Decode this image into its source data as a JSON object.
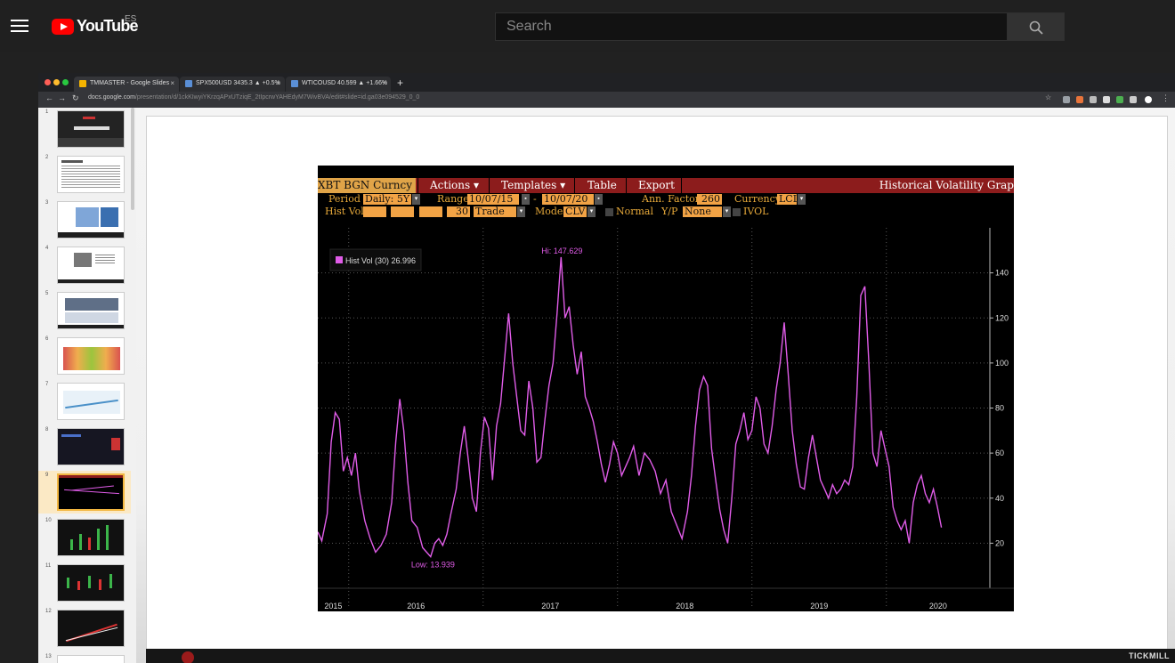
{
  "youtube": {
    "logo_text": "YouTube",
    "country_code": "ES",
    "search_placeholder": "Search"
  },
  "browser": {
    "tabs": [
      {
        "title": "TMMASTER - Google Slides",
        "color": "#f4b400"
      },
      {
        "title": "SPX500USD 3435.3 ▲ +0.5%",
        "color": "#5a8fd6"
      },
      {
        "title": "WTICOUSD 40.599 ▲ +1.66%",
        "color": "#5a8fd6"
      }
    ],
    "new_tab": "+",
    "url_host": "docs.google.com",
    "url_path": "/presentation/d/1ckKIwyiYKrzqAPxUTziqE_2tIpcrwYAHEdyM7WivBVA/edit#slide=id.ga03e094529_0_0"
  },
  "slides_panel": {
    "numbers": [
      "1",
      "2",
      "3",
      "4",
      "5",
      "6",
      "7",
      "8",
      "9",
      "10",
      "11",
      "12",
      "13"
    ],
    "selected": "9"
  },
  "footer": {
    "brand": "TICKMILL"
  },
  "terminal": {
    "ticker": "XBT BGN Curncy",
    "menu": [
      "Actions ▾",
      "Templates ▾",
      "Table",
      "Export"
    ],
    "title": "Historical Volatility Grap",
    "row1": {
      "period_label": "Period",
      "period_value": "Daily: 5Y",
      "range_label": "Range",
      "range_start": "10/07/15",
      "range_sep": "-",
      "range_end": "10/07/20",
      "ann_label": "Ann. Factor",
      "ann_value": "260",
      "currency_label": "Currency",
      "currency_value": "LCL"
    },
    "row2": {
      "histvol_label": "Hist Vol",
      "window_value": "30",
      "trade_value": "Trade",
      "model_label": "Model",
      "model_value": "CLV",
      "normal_label": "Normal",
      "yp_label": "Y/P",
      "yp_value": "None",
      "ivol_label": "IVOL"
    },
    "line_color": "#e05ce8",
    "accent_color": "#f2a345",
    "menu_color": "#8c1c1c"
  },
  "chart_data": {
    "type": "line",
    "legend": "Hist Vol (30) 26.996",
    "annotations": {
      "high": "Hi: 147.629",
      "low": "Low: 13.939"
    },
    "x_ticks": [
      "2015",
      "2016",
      "2017",
      "2018",
      "2019",
      "2020"
    ],
    "y_ticks": [
      20,
      40,
      60,
      80,
      100,
      120,
      140
    ],
    "ylim": [
      0,
      160
    ],
    "xlim": [
      2015.77,
      2020.77
    ],
    "series": [
      {
        "name": "Hist Vol (30)",
        "points": [
          [
            2015.77,
            25
          ],
          [
            2015.8,
            21
          ],
          [
            2015.84,
            33
          ],
          [
            2015.87,
            65
          ],
          [
            2015.9,
            78
          ],
          [
            2015.93,
            75
          ],
          [
            2015.96,
            52
          ],
          [
            2015.99,
            58
          ],
          [
            2016.02,
            50
          ],
          [
            2016.05,
            60
          ],
          [
            2016.08,
            43
          ],
          [
            2016.12,
            30
          ],
          [
            2016.16,
            22
          ],
          [
            2016.2,
            16
          ],
          [
            2016.24,
            19
          ],
          [
            2016.28,
            24
          ],
          [
            2016.32,
            38
          ],
          [
            2016.35,
            65
          ],
          [
            2016.38,
            84
          ],
          [
            2016.41,
            70
          ],
          [
            2016.44,
            47
          ],
          [
            2016.47,
            30
          ],
          [
            2016.51,
            27
          ],
          [
            2016.55,
            18
          ],
          [
            2016.58,
            16
          ],
          [
            2016.61,
            14
          ],
          [
            2016.64,
            20
          ],
          [
            2016.67,
            22
          ],
          [
            2016.7,
            19
          ],
          [
            2016.73,
            24
          ],
          [
            2016.76,
            33
          ],
          [
            2016.8,
            44
          ],
          [
            2016.83,
            60
          ],
          [
            2016.86,
            72
          ],
          [
            2016.89,
            57
          ],
          [
            2016.92,
            40
          ],
          [
            2016.95,
            34
          ],
          [
            2016.98,
            60
          ],
          [
            2017.01,
            76
          ],
          [
            2017.04,
            71
          ],
          [
            2017.07,
            48
          ],
          [
            2017.1,
            72
          ],
          [
            2017.13,
            82
          ],
          [
            2017.16,
            102
          ],
          [
            2017.19,
            122
          ],
          [
            2017.22,
            100
          ],
          [
            2017.25,
            85
          ],
          [
            2017.28,
            70
          ],
          [
            2017.31,
            68
          ],
          [
            2017.34,
            92
          ],
          [
            2017.37,
            80
          ],
          [
            2017.4,
            56
          ],
          [
            2017.43,
            58
          ],
          [
            2017.46,
            75
          ],
          [
            2017.49,
            90
          ],
          [
            2017.52,
            100
          ],
          [
            2017.55,
            122
          ],
          [
            2017.58,
            147
          ],
          [
            2017.61,
            120
          ],
          [
            2017.64,
            125
          ],
          [
            2017.67,
            108
          ],
          [
            2017.7,
            95
          ],
          [
            2017.73,
            105
          ],
          [
            2017.76,
            85
          ],
          [
            2017.79,
            80
          ],
          [
            2017.82,
            74
          ],
          [
            2017.85,
            65
          ],
          [
            2017.88,
            55
          ],
          [
            2017.91,
            47
          ],
          [
            2017.94,
            55
          ],
          [
            2017.97,
            65
          ],
          [
            2018.0,
            60
          ],
          [
            2018.03,
            50
          ],
          [
            2018.06,
            54
          ],
          [
            2018.09,
            58
          ],
          [
            2018.12,
            63
          ],
          [
            2018.16,
            50
          ],
          [
            2018.2,
            60
          ],
          [
            2018.24,
            57
          ],
          [
            2018.28,
            52
          ],
          [
            2018.32,
            42
          ],
          [
            2018.36,
            48
          ],
          [
            2018.4,
            34
          ],
          [
            2018.44,
            28
          ],
          [
            2018.48,
            22
          ],
          [
            2018.52,
            34
          ],
          [
            2018.55,
            50
          ],
          [
            2018.58,
            72
          ],
          [
            2018.61,
            88
          ],
          [
            2018.64,
            94
          ],
          [
            2018.67,
            90
          ],
          [
            2018.7,
            62
          ],
          [
            2018.73,
            48
          ],
          [
            2018.76,
            35
          ],
          [
            2018.79,
            26
          ],
          [
            2018.82,
            20
          ],
          [
            2018.85,
            40
          ],
          [
            2018.88,
            64
          ],
          [
            2018.91,
            70
          ],
          [
            2018.94,
            78
          ],
          [
            2018.97,
            66
          ],
          [
            2019.0,
            70
          ],
          [
            2019.03,
            85
          ],
          [
            2019.06,
            80
          ],
          [
            2019.09,
            64
          ],
          [
            2019.12,
            60
          ],
          [
            2019.15,
            72
          ],
          [
            2019.18,
            88
          ],
          [
            2019.21,
            100
          ],
          [
            2019.24,
            118
          ],
          [
            2019.27,
            95
          ],
          [
            2019.3,
            70
          ],
          [
            2019.33,
            55
          ],
          [
            2019.36,
            45
          ],
          [
            2019.39,
            44
          ],
          [
            2019.42,
            58
          ],
          [
            2019.45,
            68
          ],
          [
            2019.48,
            58
          ],
          [
            2019.51,
            48
          ],
          [
            2019.54,
            44
          ],
          [
            2019.57,
            40
          ],
          [
            2019.6,
            46
          ],
          [
            2019.63,
            42
          ],
          [
            2019.66,
            44
          ],
          [
            2019.69,
            48
          ],
          [
            2019.72,
            46
          ],
          [
            2019.75,
            54
          ],
          [
            2019.78,
            85
          ],
          [
            2019.81,
            130
          ],
          [
            2019.84,
            134
          ],
          [
            2019.87,
            100
          ],
          [
            2019.9,
            60
          ],
          [
            2019.93,
            54
          ],
          [
            2019.96,
            70
          ],
          [
            2019.99,
            62
          ],
          [
            2020.02,
            54
          ],
          [
            2020.05,
            36
          ],
          [
            2020.08,
            30
          ],
          [
            2020.11,
            26
          ],
          [
            2020.14,
            30
          ],
          [
            2020.17,
            20
          ],
          [
            2020.2,
            38
          ],
          [
            2020.23,
            46
          ],
          [
            2020.26,
            50
          ],
          [
            2020.29,
            42
          ],
          [
            2020.32,
            38
          ],
          [
            2020.35,
            44
          ],
          [
            2020.38,
            36
          ],
          [
            2020.41,
            27
          ]
        ]
      }
    ]
  }
}
